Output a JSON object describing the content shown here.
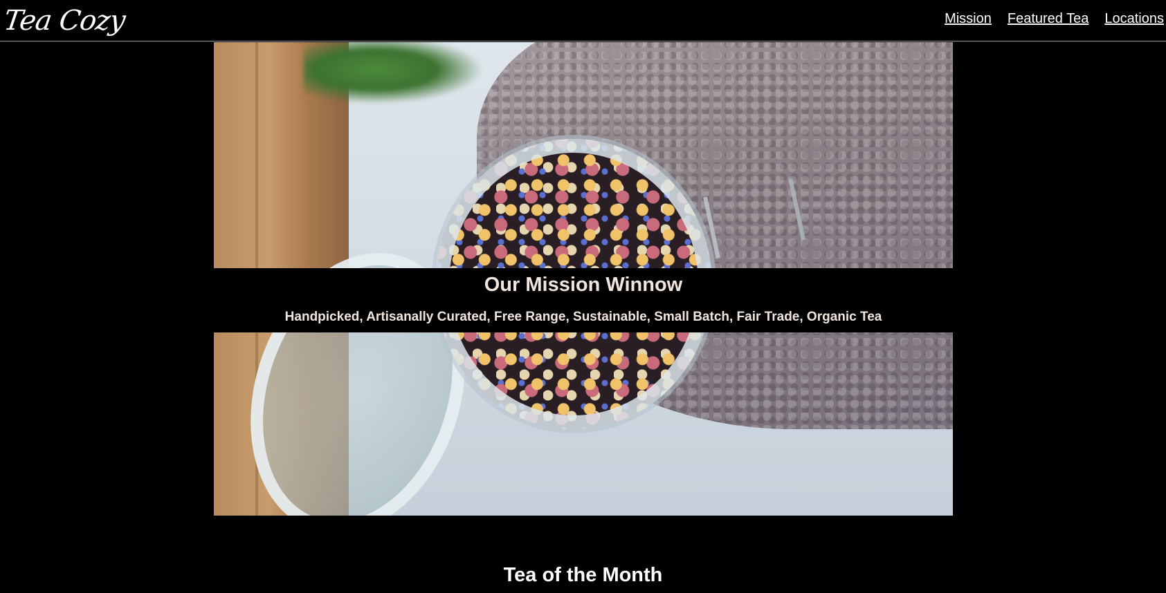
{
  "header": {
    "logo": "Tea Cozy",
    "nav": [
      {
        "label": "Mission"
      },
      {
        "label": "Featured Tea"
      },
      {
        "label": "Locations"
      }
    ]
  },
  "hero": {
    "image": "tea-jar-photo"
  },
  "mission": {
    "title": "Our Mission Winnow",
    "subtitle": "Handpicked, Artisanally Curated, Free Range, Sustainable, Small Batch, Fair Trade, Organic Tea"
  },
  "section": {
    "title": "Tea of the Month"
  },
  "colors": {
    "background": "#000000",
    "text": "#ffffff",
    "mission_text": "#f0e6de"
  }
}
